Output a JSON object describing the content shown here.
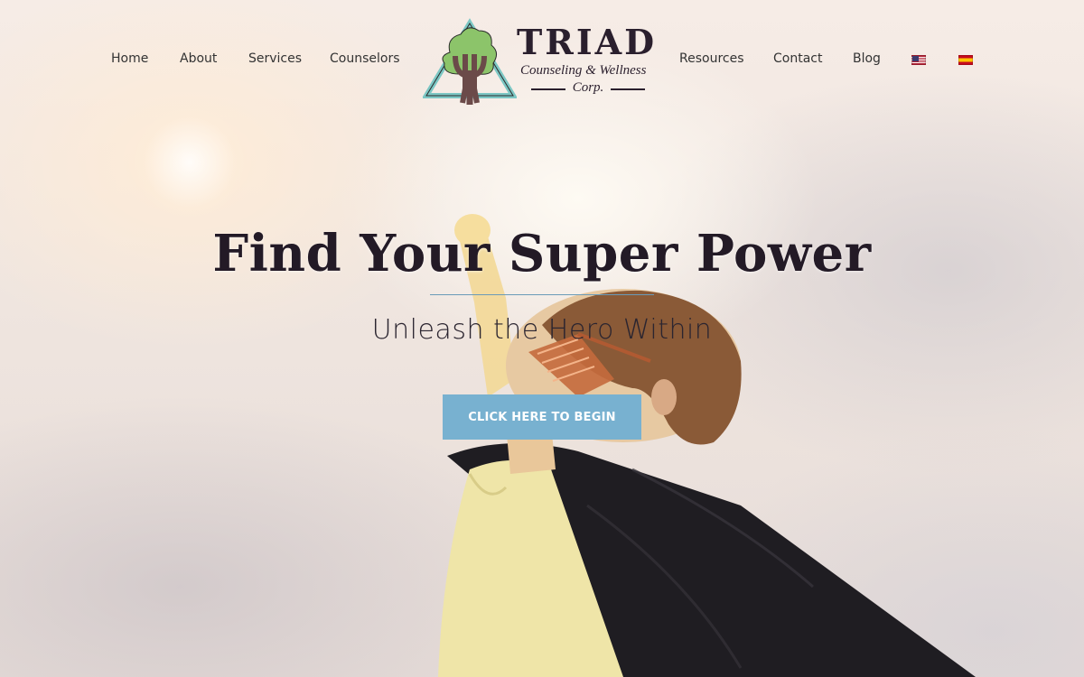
{
  "nav": {
    "left": [
      {
        "label": "Home"
      },
      {
        "label": "About"
      },
      {
        "label": "Services"
      },
      {
        "label": "Counselors"
      }
    ],
    "right": [
      {
        "label": "Resources"
      },
      {
        "label": "Contact"
      },
      {
        "label": "Blog"
      }
    ],
    "languages": [
      {
        "icon": "us-flag-icon",
        "lang": "English"
      },
      {
        "icon": "spain-flag-icon",
        "lang": "Español"
      }
    ]
  },
  "logo": {
    "title": "TRIAD",
    "subtitle": "Counseling & Wellness",
    "corp": "Corp.",
    "icon": "tree-triangle-psi-logo"
  },
  "hero": {
    "headline": "Find Your Super Power",
    "subheadline": "Unleash the Hero Within",
    "cta_label": "CLICK HERE TO BEGIN"
  },
  "colors": {
    "accent": "#78b1d0",
    "heading": "#231a26",
    "divider": "#6a9bb8"
  }
}
